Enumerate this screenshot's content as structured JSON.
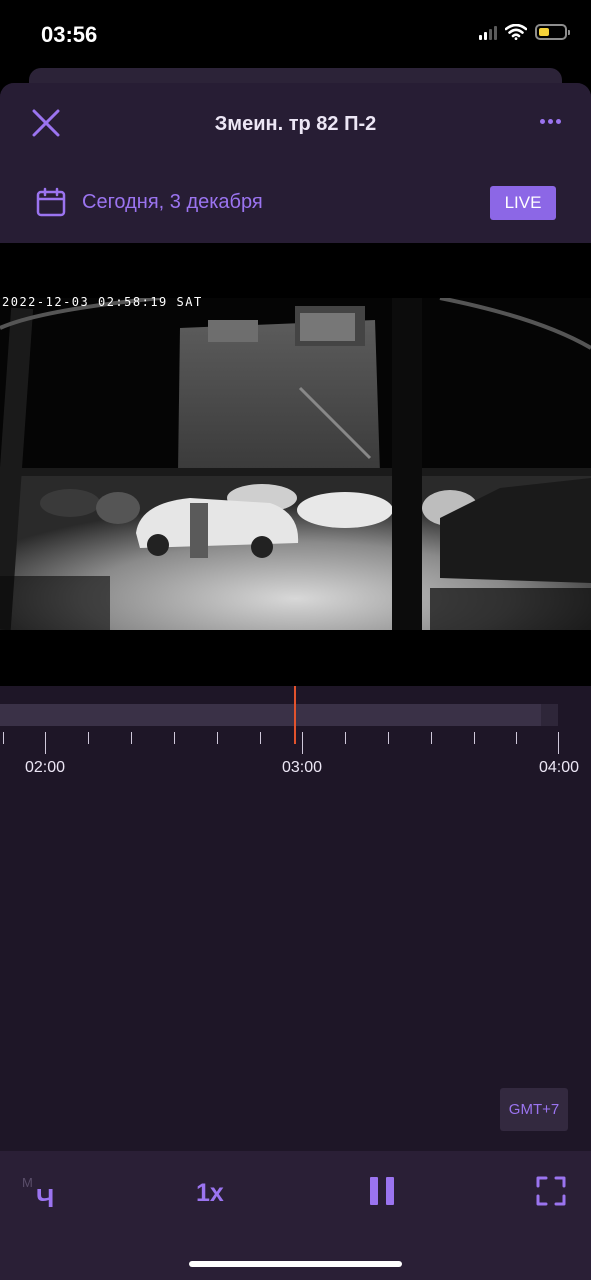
{
  "status_bar": {
    "time": "03:56"
  },
  "header": {
    "title": "Змеин. тр 82 П-2",
    "date": "Сегодня, 3 декабря",
    "live_label": "LIVE"
  },
  "video": {
    "overlay_timestamp": "2022-12-03 02:58:19 SAT"
  },
  "timeline": {
    "labels": [
      "02:00",
      "03:00",
      "04:00"
    ]
  },
  "timezone_label": "GMT+7",
  "controls": {
    "mode_small": "М",
    "mode_big": "Ч",
    "speed": "1x"
  },
  "colors": {
    "accent": "#9b74f0",
    "playhead": "#e2532d",
    "background": "#1e1627"
  }
}
